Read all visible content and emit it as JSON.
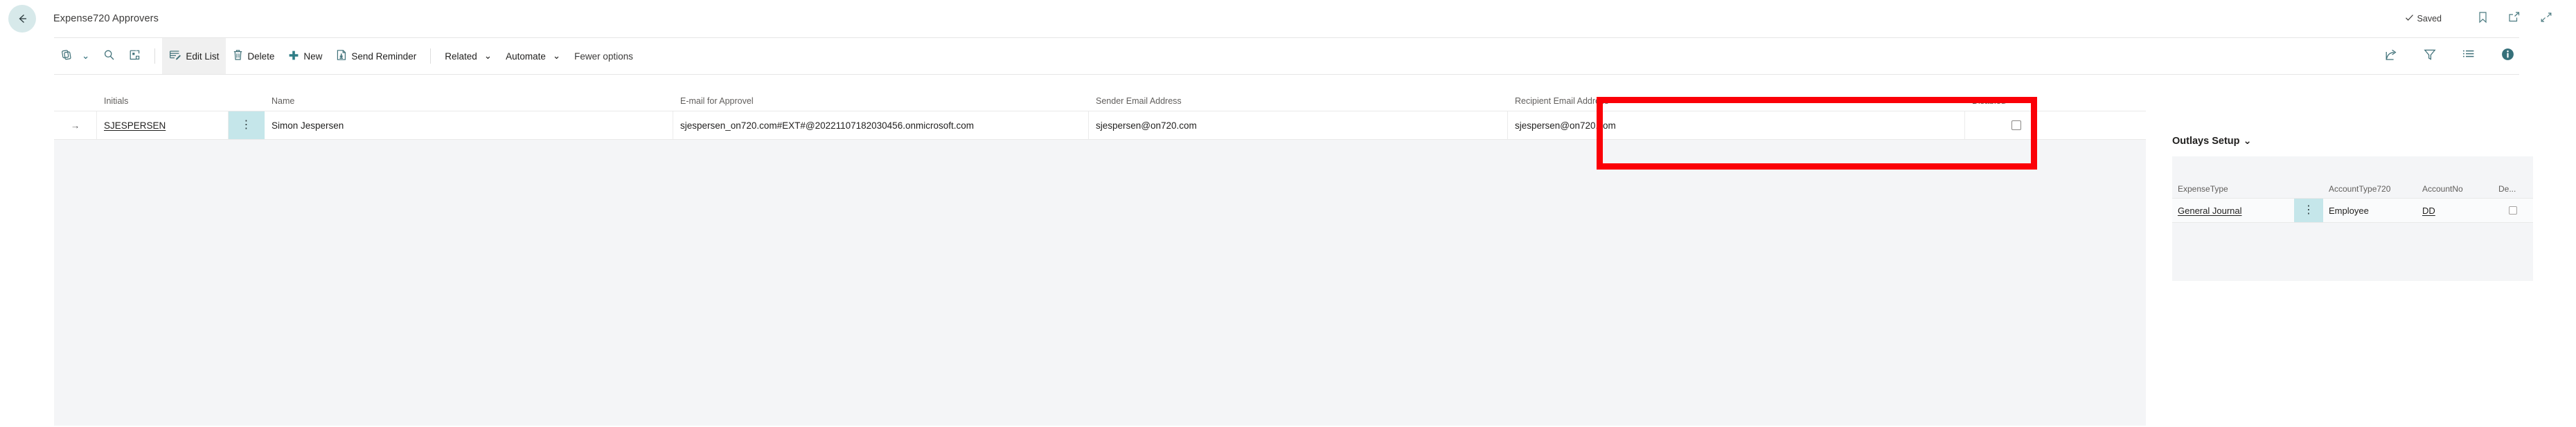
{
  "header": {
    "back_icon": "back-arrow-icon",
    "title": "Expense720 Approvers",
    "saved_label": "Saved",
    "saved_icon": "checkmark-icon",
    "bookmark_icon": "bookmark-icon",
    "open_new_window_icon": "open-in-new-window-icon",
    "collapse_icon": "collapse-arrows-icon"
  },
  "commandbar": {
    "share_group_icon": "pages-and-share-icon",
    "search_icon": "search-icon",
    "open_in_excel_icon": "open-in-excel-icon",
    "edit_list": "Edit List",
    "edit_list_icon": "edit-list-icon",
    "delete": "Delete",
    "delete_icon": "trash-icon",
    "new": "New",
    "new_icon": "plus-icon",
    "send_reminder": "Send Reminder",
    "send_reminder_icon": "send-reminder-icon",
    "related": "Related",
    "automate": "Automate",
    "fewer_options": "Fewer options",
    "chevron": "⌄",
    "right_icons": {
      "share": "share-icon",
      "filter": "filter-icon",
      "list": "list-view-icon",
      "info": "info-icon"
    }
  },
  "grid": {
    "columns": [
      "Initials",
      "Name",
      "E-mail for Approvel",
      "Sender Email Address",
      "Recipient Email Address",
      "Disabled"
    ],
    "rows": [
      {
        "row_indicator": "→",
        "initials": "SJESPERSEN",
        "name": "Simon Jespersen",
        "email_for_approvel": "sjespersen_on720.com#EXT#@20221107182030456.onmicrosoft.com",
        "sender_email_address": "sjespersen@on720.com",
        "recipient_email_address": "sjespersen@on720.com",
        "disabled": false
      }
    ]
  },
  "annotation": {
    "color": "#fb0007",
    "target_column": "Recipient Email Address"
  },
  "outlays": {
    "title": "Outlays Setup",
    "chevron": "⌄",
    "columns": [
      "ExpenseType",
      "AccountType720",
      "AccountNo",
      "De..."
    ],
    "rows": [
      {
        "expense_type": "General Journal",
        "account_type_720": "Employee",
        "account_no": "DD",
        "de": false
      }
    ]
  }
}
